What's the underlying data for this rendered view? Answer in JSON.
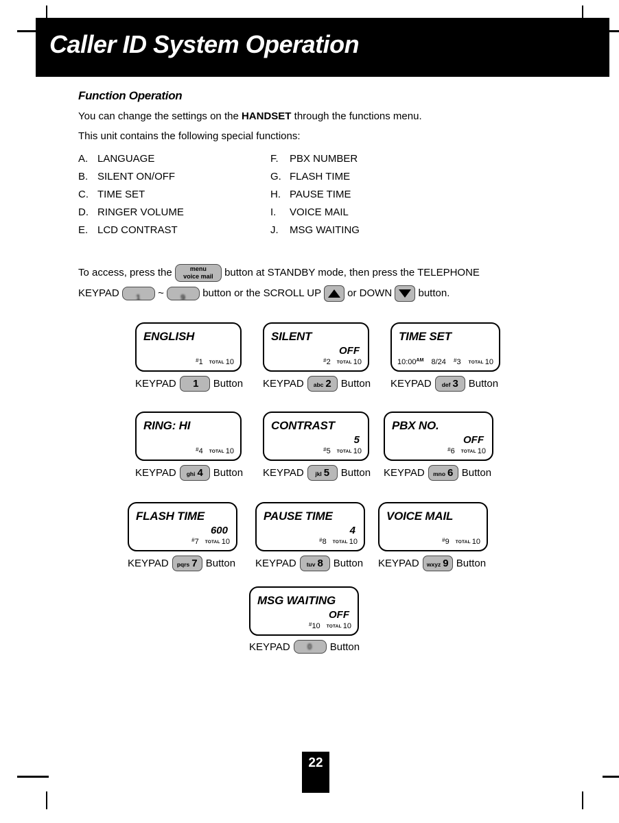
{
  "header": {
    "title": "Caller ID System Operation"
  },
  "section": {
    "heading": "Function Operation",
    "intro_pre": "You can change the settings on the ",
    "intro_bold": "HANDSET",
    "intro_post": " through the functions menu.",
    "subintro": "This unit contains the following special functions:"
  },
  "functions": {
    "left": [
      {
        "letter": "A.",
        "label": "LANGUAGE"
      },
      {
        "letter": "B.",
        "label": "SILENT ON/OFF"
      },
      {
        "letter": "C.",
        "label": "TIME SET"
      },
      {
        "letter": "D.",
        "label": "RINGER VOLUME"
      },
      {
        "letter": "E.",
        "label": "LCD CONTRAST"
      }
    ],
    "right": [
      {
        "letter": "F.",
        "label": "PBX NUMBER"
      },
      {
        "letter": "G.",
        "label": "FLASH TIME"
      },
      {
        "letter": "H.",
        "label": "PAUSE TIME"
      },
      {
        "letter": "I.",
        "label": "VOICE MAIL"
      },
      {
        "letter": "J.",
        "label": "MSG WAITING"
      }
    ]
  },
  "access_note": {
    "t1": "To  access,  press  the",
    "menu_key_line1": "menu",
    "menu_key_line2": "voice mail",
    "t2": "button  at  STANDBY  mode,  then  press  the  TELEPHONE",
    "t3": "KEYPAD",
    "key_low": "1",
    "tilde": "~",
    "key_high": "9",
    "t4": "button or the SCROLL  UP",
    "t5": "or DOWN",
    "t6": "button.",
    "up_icon": "triangle-up-icon",
    "down_icon": "triangle-down-icon"
  },
  "keypad_caption": {
    "prefix": "KEYPAD",
    "suffix": "Button"
  },
  "lcd_labels": {
    "total": "TOTAL",
    "hash": "#"
  },
  "panels": [
    {
      "title": "ENGLISH",
      "value": "",
      "index": "1",
      "total": "10",
      "key_letters": "",
      "key_digit": "1"
    },
    {
      "title": "SILENT",
      "value": "OFF",
      "index": "2",
      "total": "10",
      "key_letters": "abc",
      "key_digit": "2"
    },
    {
      "title": "TIME SET",
      "value": "",
      "clock": "10:00",
      "ampm": "AM",
      "date": "8/24",
      "index": "3",
      "total": "10",
      "key_letters": "def",
      "key_digit": "3"
    },
    {
      "title": "RING: HI",
      "value": "",
      "index": "4",
      "total": "10",
      "key_letters": "ghi",
      "key_digit": "4"
    },
    {
      "title": "CONTRAST",
      "value": "5",
      "index": "5",
      "total": "10",
      "key_letters": "jkl",
      "key_digit": "5"
    },
    {
      "title": "PBX NO.",
      "value": "OFF",
      "index": "6",
      "total": "10",
      "key_letters": "mno",
      "key_digit": "6"
    },
    {
      "title": "FLASH TIME",
      "value": "600",
      "index": "7",
      "total": "10",
      "key_letters": "pqrs",
      "key_digit": "7"
    },
    {
      "title": "PAUSE TIME",
      "value": "4",
      "index": "8",
      "total": "10",
      "key_letters": "tuv",
      "key_digit": "8"
    },
    {
      "title": "VOICE MAIL",
      "value": "",
      "index": "9",
      "total": "10",
      "key_letters": "wxyz",
      "key_digit": "9"
    },
    {
      "title": "MSG WAITING",
      "value": "OFF",
      "index": "10",
      "total": "10",
      "key_letters": "",
      "key_digit": "0",
      "key_blurred": true
    }
  ],
  "footer": {
    "page_number": "22"
  }
}
